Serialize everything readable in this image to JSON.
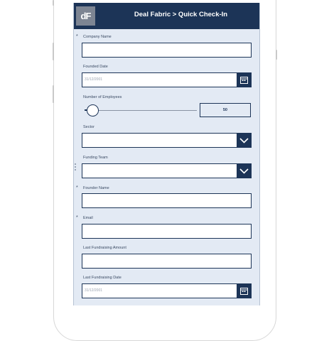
{
  "app": {
    "title": "Deal Fabric > Quick Check-In",
    "logo_text": "dF"
  },
  "form": {
    "company_name": {
      "label": "Company Name",
      "required": true,
      "value": ""
    },
    "founded_date": {
      "label": "Founded Date",
      "value": "31/12/2001"
    },
    "employees": {
      "label": "Number of Employees",
      "value": "50",
      "slider_fraction": 0.05
    },
    "sector": {
      "label": "Sector",
      "selected": ""
    },
    "funding_team": {
      "label": "Funding Team",
      "selected": ""
    },
    "founder_name": {
      "label": "Founder Name",
      "required": true,
      "value": ""
    },
    "email": {
      "label": "Email",
      "required": true,
      "value": ""
    },
    "last_amount": {
      "label": "Last Fundraising Amount",
      "value": ""
    },
    "last_date": {
      "label": "Last Fundraising Date",
      "value": "31/12/2001"
    }
  },
  "required_marker": "*",
  "colors": {
    "header": "#1c3457",
    "background": "#e3eaf4",
    "field_border": "#1c3457",
    "logo_bg": "#7d8593"
  }
}
